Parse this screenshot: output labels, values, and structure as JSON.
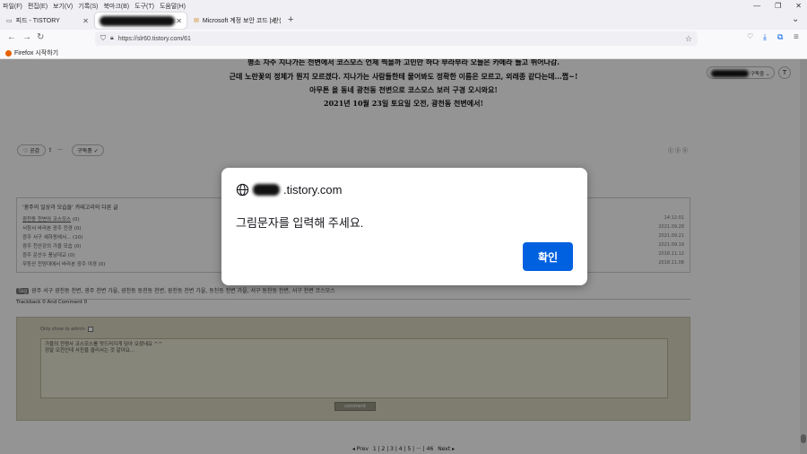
{
  "menubar": {
    "items": [
      "파일(F)",
      "편집(E)",
      "보기(V)",
      "기록(S)",
      "북마크(B)",
      "도구(T)",
      "도움말(H)"
    ],
    "minimize_glyph": "—",
    "restore_glyph": "❐",
    "close_glyph": "✕"
  },
  "tabs": [
    {
      "title": "피드 - TISTORY",
      "close": "✕"
    },
    {
      "title": "",
      "close": "✕"
    },
    {
      "title": "Microsoft 계정 보안 코드 | 받은",
      "close": "✕"
    }
  ],
  "newtab_glyph": "+",
  "tab_overflow_glyph": "⌄",
  "navbar": {
    "back_glyph": "←",
    "forward_glyph": "→",
    "reload_glyph": "↻",
    "url": "https://slr60.tistory.com/61",
    "star_glyph": "☆",
    "menu_glyph": "≡"
  },
  "bookmarks": {
    "item": "Firefox 시작하기"
  },
  "page": {
    "lines": [
      "평소 자주 지나가는 천변에서 코스모스 언제 찍을까 고민만 하다 부라부라 오늘은 카메라 들고 뛰어나감.",
      "근데 노란꽃의 정체가 뭔지 모르겠다. 지나가는 사람들한테 물어봐도 정확한 이름은 모르고, 외래종 같다는데...쩝~!",
      "아무튼 올 동네 광천동 천변으로 코스모스 보러 구경 오시와요!",
      "2021년 10월 23일 토요일 오전, 광천동 천변에서!"
    ],
    "like_label": "♡ 공감",
    "share_glyph": "⇪",
    "more_glyph": "···",
    "subscribe_label": "구독중 ✓",
    "top_subscribe_label": "구독중 ⌄",
    "license_glyphs": "ⓒ ⓢ ⓝ",
    "related_title": "'광주의 일상과 모습들' 카테고리의 다른 글",
    "related": [
      {
        "title": "광천동 천변의 코스모스",
        "count": "(0)",
        "date": "14:12:01"
      },
      {
        "title": "서창서 바라본 광주 전경",
        "count": "(0)",
        "date": "2021.09.28"
      },
      {
        "title": "광주 서구 세하동에서...",
        "count": "(10)",
        "date": "2021.09.21"
      },
      {
        "title": "광주 천산강의 가을 모습",
        "count": "(0)",
        "date": "2021.09.19"
      },
      {
        "title": "광주 운산수 풍남대교",
        "count": "(0)",
        "date": "2018.11.12"
      },
      {
        "title": "무등산 전망대에서 바라본 광주 야경",
        "count": "(0)",
        "date": "2018.11.08"
      }
    ],
    "tag_label": "Tag",
    "tags": "광주 서구 광천동 천변, 광주 천변 가을, 광천동 동천동 천변, 광천동 천변 가을, 동천동 천변 가을, 서구 동천동 천변, 서구 천변 코스모스",
    "trackback": "Trackback 0 And Comment 0",
    "only_admin": "Only show to admin",
    "comment_text": "가을의 전령사 코스모스를 멋드러지게 담아 오셨네요 ^^\n정말 오전인데 사진을 클리서는 것 같아요...",
    "comment_button": "comment",
    "pager": {
      "prev": "◂ Prev",
      "pages": "1 | 2 | 3 | 4 | 5 | ··· | 46",
      "next": "Next ▸"
    }
  },
  "dialog": {
    "origin": ".tistory.com",
    "message": "그림문자를 입력해 주세요.",
    "ok_label": "확인"
  },
  "colors": {
    "accent": "#0061e0",
    "overlay": "rgba(0,0,0,0.42)",
    "comment_bg": "#d9d7c1"
  }
}
